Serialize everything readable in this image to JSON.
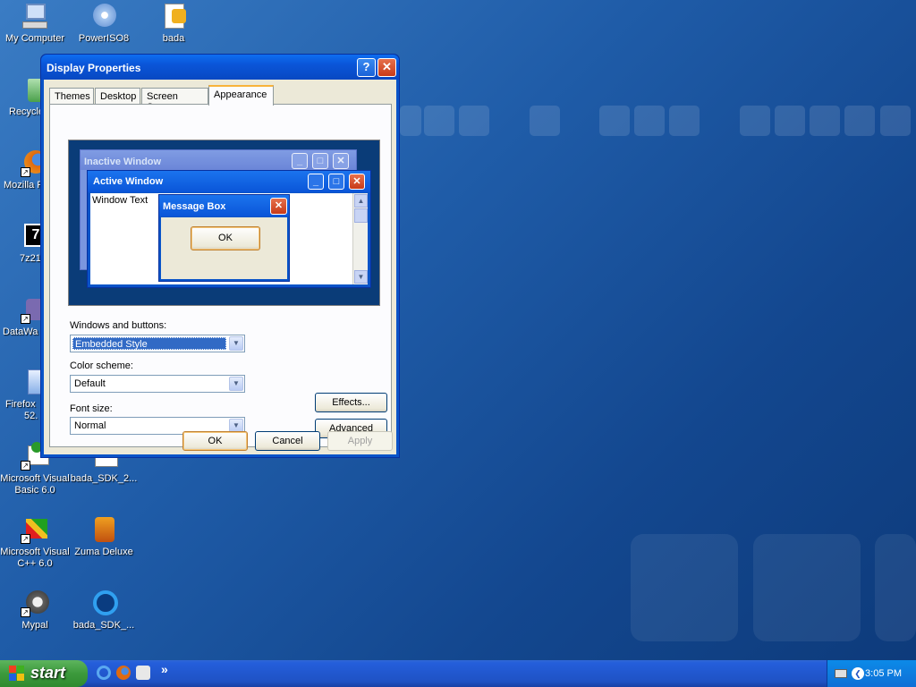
{
  "desktop_icons": [
    {
      "label": "My Computer",
      "icon": "my-computer-icon"
    },
    {
      "label": "PowerISO8",
      "icon": "poweriso-icon"
    },
    {
      "label": "bada",
      "icon": "bada-folder-icon"
    },
    {
      "label": "Recycle",
      "icon": "recycle-bin-icon"
    },
    {
      "label": "Mozilla F",
      "icon": "firefox-icon"
    },
    {
      "label": "7z21",
      "icon": "7zip-icon"
    },
    {
      "label": "DataWa",
      "icon": "datawa-icon"
    },
    {
      "label": "Firefox",
      "label2": "52.",
      "icon": "firefox-setup-icon"
    },
    {
      "label": "Microsoft Visual",
      "label2": "Basic 6.0",
      "icon": "vb6-icon"
    },
    {
      "label": "bada_SDK_2...",
      "icon": "bada-sdk-installer-icon"
    },
    {
      "label": "Microsoft Visual",
      "label2": "C++ 6.0",
      "icon": "vc6-icon"
    },
    {
      "label": "Zuma Deluxe",
      "icon": "zuma-icon"
    },
    {
      "label": "Mypal",
      "icon": "mypal-icon"
    },
    {
      "label": "bada_SDK_...",
      "icon": "bada-sdk-icon"
    }
  ],
  "dialog": {
    "title": "Display Properties",
    "help": "?",
    "close": "✕",
    "tabs": [
      "Themes",
      "Desktop",
      "Screen Saver",
      "Appearance"
    ],
    "active_tab": "Appearance",
    "preview": {
      "inactive_title": "Inactive Window",
      "active_title": "Active Window",
      "window_text": "Window Text",
      "message_title": "Message Box",
      "ok": "OK"
    },
    "windows_buttons_label": "Windows and buttons:",
    "windows_buttons_value": "Embedded Style",
    "color_scheme_label": "Color scheme:",
    "color_scheme_value": "Default",
    "font_size_label": "Font size:",
    "font_size_value": "Normal",
    "effects": "Effects...",
    "advanced": "Advanced",
    "ok": "OK",
    "cancel": "Cancel",
    "apply": "Apply"
  },
  "taskbar": {
    "start": "start",
    "more": "»",
    "clock": "3:05 PM"
  },
  "colors": {
    "title_blue": "#0a55d8",
    "dialog_face": "#ece9d8",
    "start_green": "#3c9a3c"
  }
}
